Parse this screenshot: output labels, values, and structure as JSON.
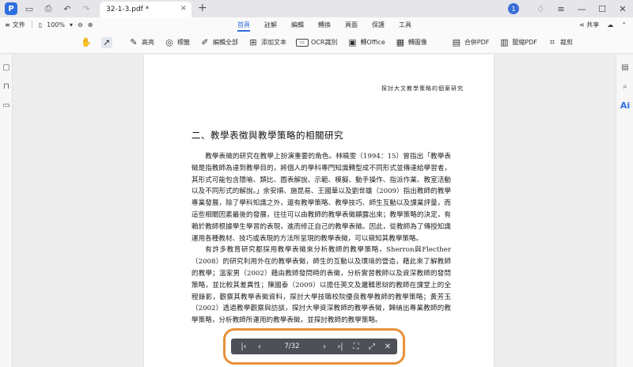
{
  "titlebar": {
    "app_logo": "P",
    "tab_title": "32-1-3.pdf *",
    "tab_close": "×",
    "new_tab": "+",
    "avatar_text": "1",
    "icons": [
      "folder-icon",
      "print-icon",
      "undo-icon",
      "redo-icon",
      "dropdown-icon"
    ]
  },
  "menu": {
    "file_label": "文件",
    "zoom_value": "100%",
    "tabs": [
      "首頁",
      "註解",
      "編輯",
      "轉換",
      "頁面",
      "保護",
      "工具"
    ],
    "active_tab": "首頁",
    "share_label": "共享"
  },
  "tools": [
    {
      "label": "",
      "icon": "hand-icon"
    },
    {
      "label": "",
      "icon": "cursor-icon"
    },
    {
      "label": "高亮",
      "icon": "highlight-icon"
    },
    {
      "label": "標籤",
      "icon": "tag-icon"
    },
    {
      "label": "編輯全部",
      "icon": "edit-icon"
    },
    {
      "label": "添加文本",
      "icon": "add-text-icon"
    },
    {
      "label": "OCR識別",
      "icon": "ocr-icon"
    },
    {
      "label": "轉Office",
      "icon": "to-office-icon"
    },
    {
      "label": "轉圖像",
      "icon": "to-image-icon"
    },
    {
      "label": "合併PDF",
      "icon": "merge-icon"
    },
    {
      "label": "壓縮PDF",
      "icon": "compress-icon"
    },
    {
      "label": "裁剪",
      "icon": "crop-icon"
    }
  ],
  "document": {
    "running_header": "探討大文教學策略的個案研究",
    "section_title": "二、教學表徵與教學策略的相關研究",
    "paragraphs": [
      "教學表徵的研究在教學上扮演重要的角色。林曉雯（1994：15）曾指出「教學表徵是指教師為達到教學目的，將個人的學科專門知識轉型成不同形式並傳達給學習者，其形式可能包含隱喻、類比、圖表解說、示範、模擬、動手操作、指派作業、教室活動以及不同形式的解說。」余安順、施昆易、王國華以及劉世雄（2009）指出教師的教學專業發展，除了學科知識之外，還有教學策略、教學技巧、師生互動以及課業評量，而這些相關因素最後的發展，往往可以由教師的教學表徵顯露出來；教學策略的決定，有賴於教師根據學生學習的表現，進而修正自己的教學表徵。因此，從教師為了傳授知識運用各種教材、技巧或表現的方法所呈現的教學表徵，可以窺知其教學策略。",
      "有許多教育研究都採用教學表徵來分析教師的教學策略，Sherron與Flecther（2008）的研究利用外在的教學表徵，師生的互動以及環境的營造，藉此來了解教師的教學；溫家男（2002）藉由教師發問時的表徵，分析實習教師以及資深教師的發問策略，並比較其差異性；陳國泰（2009）以擔任英文及邏輯思辯的教師在課堂上的全程錄影，觀察其教學表徵資料，探討大學技職校院優良教學教師的教學策略；黃芳玉（2002）透過教學觀察與訪談，探討大學資深教師的教學表徵，歸納出專業教師的教學策略，分析教師所運用的教學表徵，並探討教師的教學策略。"
    ]
  },
  "pagenav": {
    "page_indicator": "7/32"
  }
}
